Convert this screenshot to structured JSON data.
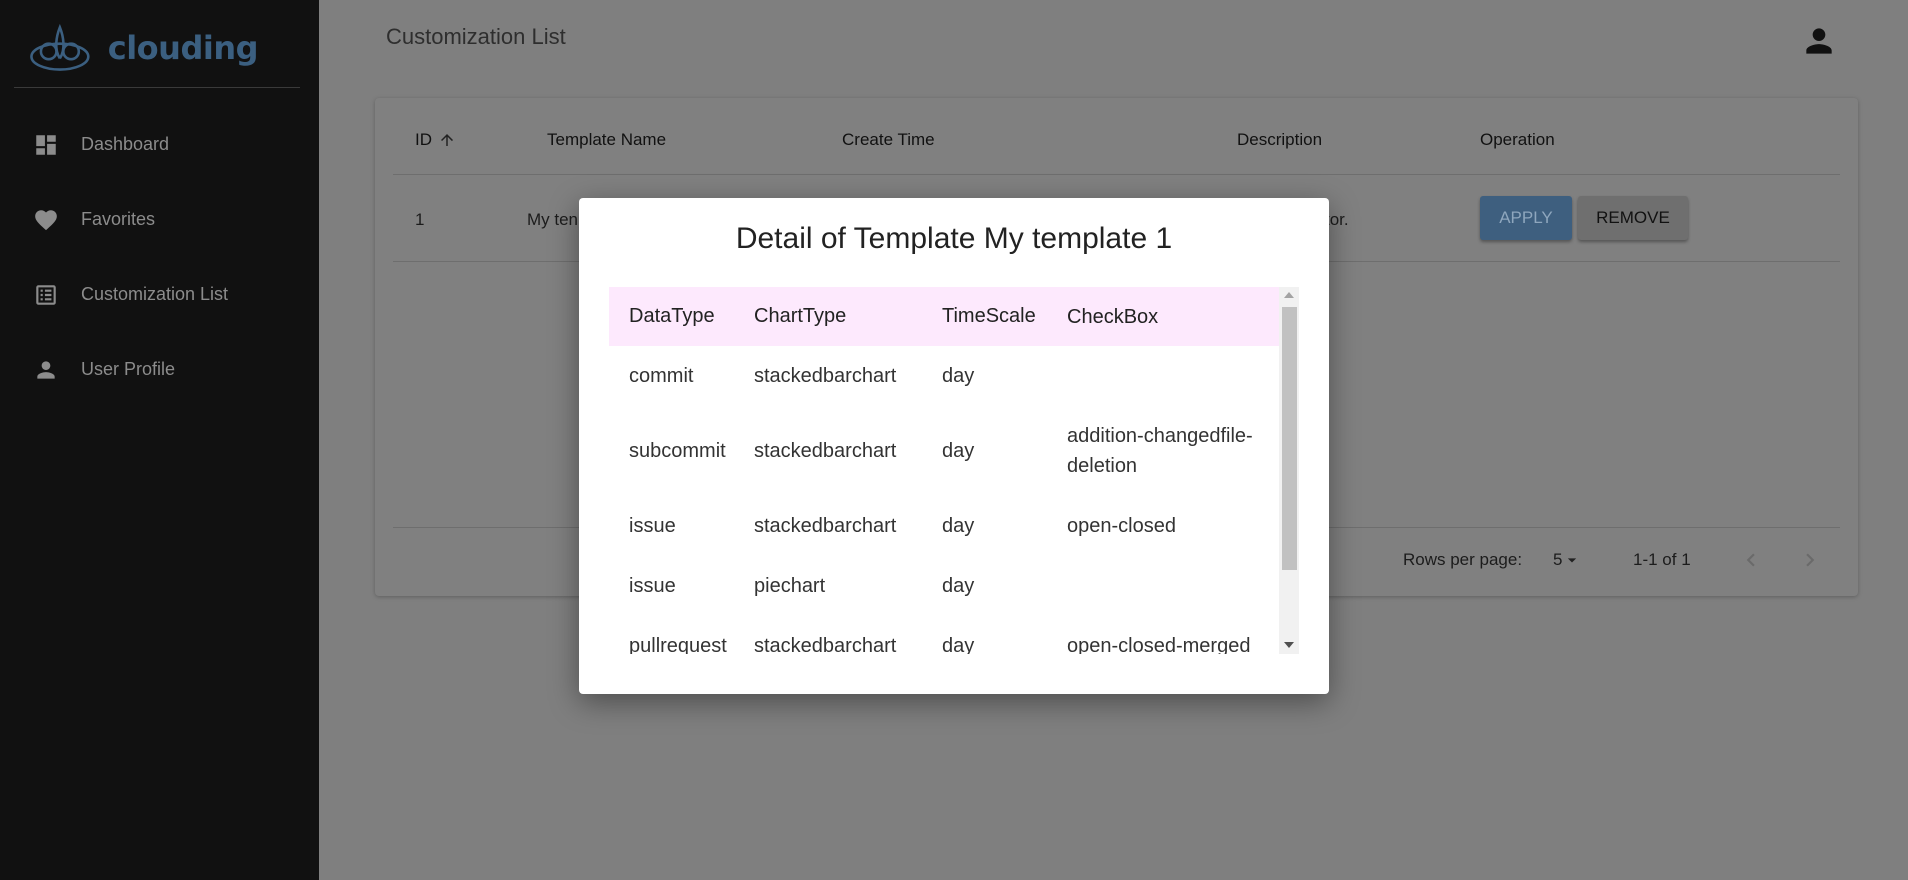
{
  "sidebar": {
    "logo_text": "clouding",
    "items": [
      {
        "label": "Dashboard",
        "icon": "dashboard-icon"
      },
      {
        "label": "Favorites",
        "icon": "heart-icon"
      },
      {
        "label": "Customization List",
        "icon": "list-icon"
      },
      {
        "label": "User Profile",
        "icon": "person-icon"
      }
    ]
  },
  "header": {
    "title": "Customization List",
    "account_icon": "account-icon"
  },
  "table": {
    "columns": [
      "ID",
      "Template Name",
      "Create Time",
      "Description",
      "Operation"
    ],
    "sort_column": "ID",
    "sort_direction": "ascending",
    "rows": [
      {
        "id": "1",
        "name": "My ten",
        "description": "tor."
      }
    ],
    "apply_label": "APPLY",
    "remove_label": "REMOVE",
    "rows_per_page_label": "Rows per page:",
    "rows_per_page_value": "5",
    "range_label": "1-1 of 1"
  },
  "modal": {
    "title": "Detail of Template My template 1",
    "columns": [
      "DataType",
      "ChartType",
      "TimeScale",
      "CheckBox"
    ],
    "rows": [
      {
        "datatype": "commit",
        "charttype": "stackedbarchart",
        "timescale": "day",
        "checkbox": ""
      },
      {
        "datatype": "subcommit",
        "charttype": "stackedbarchart",
        "timescale": "day",
        "checkbox": "addition-changedfile-deletion"
      },
      {
        "datatype": "issue",
        "charttype": "stackedbarchart",
        "timescale": "day",
        "checkbox": "open-closed"
      },
      {
        "datatype": "issue",
        "charttype": "piechart",
        "timescale": "day",
        "checkbox": ""
      },
      {
        "datatype": "pullrequest",
        "charttype": "stackedbarchart",
        "timescale": "day",
        "checkbox": "open-closed-merged"
      }
    ]
  },
  "colors": {
    "sidebar_bg": "#111111",
    "overlay_bg": "#7f7f7f",
    "brand": "#3b5f80",
    "modal_header_bg": "#fde9fd"
  }
}
